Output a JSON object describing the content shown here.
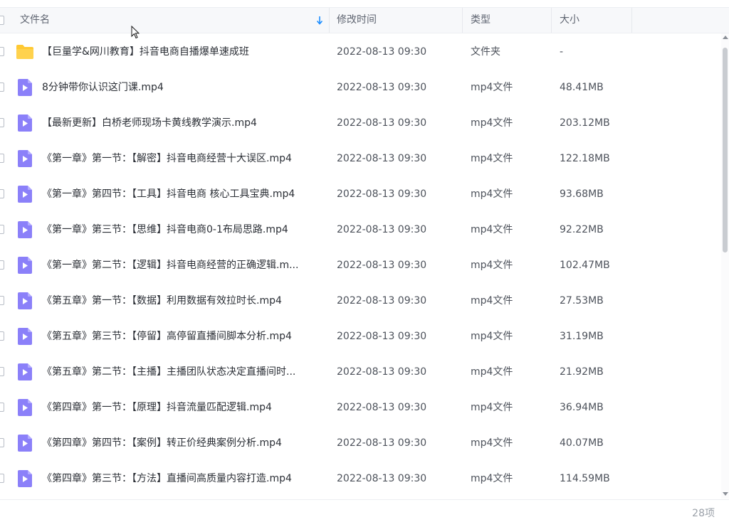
{
  "header": {
    "name": "文件名",
    "modified": "修改时间",
    "type": "类型",
    "size": "大小"
  },
  "colors": {
    "sort_arrow": "#1a8cff",
    "video_icon": "#8b80f9",
    "folder_icon": "#ffc933"
  },
  "files": [
    {
      "icon": "folder-icon",
      "name": "【巨量学&网川教育】抖音电商自播爆单速成班",
      "time": "2022-08-13 09:30",
      "type": "文件夹",
      "size": "-"
    },
    {
      "icon": "video-file-icon",
      "name": "8分钟带你认识这门课.mp4",
      "time": "2022-08-13 09:30",
      "type": "mp4文件",
      "size": "48.41MB"
    },
    {
      "icon": "video-file-icon",
      "name": "【最新更新】白桥老师现场卡黄线教学演示.mp4",
      "time": "2022-08-13 09:30",
      "type": "mp4文件",
      "size": "203.12MB"
    },
    {
      "icon": "video-file-icon",
      "name": "《第一章》第一节：【解密】抖音电商经营十大误区.mp4",
      "time": "2022-08-13 09:30",
      "type": "mp4文件",
      "size": "122.18MB"
    },
    {
      "icon": "video-file-icon",
      "name": "《第一章》第四节：【工具】抖音电商 核心工具宝典.mp4",
      "time": "2022-08-13 09:30",
      "type": "mp4文件",
      "size": "93.68MB"
    },
    {
      "icon": "video-file-icon",
      "name": "《第一章》第三节：【思维】抖音电商0-1布局思路.mp4",
      "time": "2022-08-13 09:30",
      "type": "mp4文件",
      "size": "92.22MB"
    },
    {
      "icon": "video-file-icon",
      "name": "《第一章》第二节：【逻辑】抖音电商经营的正确逻辑.m...",
      "time": "2022-08-13 09:30",
      "type": "mp4文件",
      "size": "102.47MB"
    },
    {
      "icon": "video-file-icon",
      "name": "《第五章》第一节：【数据】利用数据有效拉时长.mp4",
      "time": "2022-08-13 09:30",
      "type": "mp4文件",
      "size": "27.53MB"
    },
    {
      "icon": "video-file-icon",
      "name": "《第五章》第三节：【停留】高停留直播间脚本分析.mp4",
      "time": "2022-08-13 09:30",
      "type": "mp4文件",
      "size": "31.19MB"
    },
    {
      "icon": "video-file-icon",
      "name": "《第五章》第二节：【主播】主播团队状态决定直播间时...",
      "time": "2022-08-13 09:30",
      "type": "mp4文件",
      "size": "21.92MB"
    },
    {
      "icon": "video-file-icon",
      "name": "《第四章》第一节：【原理】抖音流量匹配逻辑.mp4",
      "time": "2022-08-13 09:30",
      "type": "mp4文件",
      "size": "36.94MB"
    },
    {
      "icon": "video-file-icon",
      "name": "《第四章》第四节：【案例】转正价经典案例分析.mp4",
      "time": "2022-08-13 09:30",
      "type": "mp4文件",
      "size": "40.07MB"
    },
    {
      "icon": "video-file-icon",
      "name": "《第四章》第三节：【方法】直播间高质量内容打造.mp4",
      "time": "2022-08-13 09:30",
      "type": "mp4文件",
      "size": "114.59MB"
    }
  ],
  "footer": {
    "count": "28项"
  }
}
